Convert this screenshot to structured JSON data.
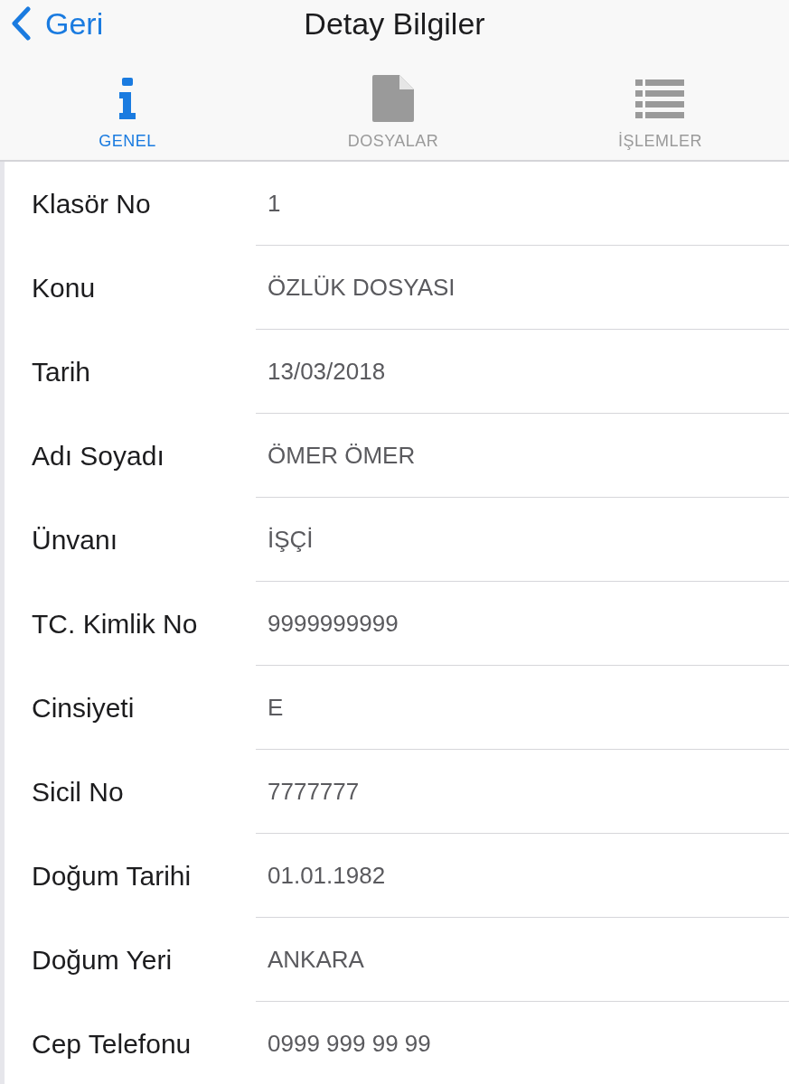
{
  "nav_bar": {
    "back": {
      "label": "Geri"
    },
    "title": "Detay Bilgiler"
  },
  "tabs": [
    {
      "label": "GENEL",
      "kind": "info",
      "selected": true
    },
    {
      "label": "DOSYALAR",
      "kind": "file",
      "selected": false
    },
    {
      "label": "İŞLEMLER",
      "kind": "list",
      "selected": false
    }
  ],
  "fields": [
    {
      "label": "Klasör No",
      "value": "1"
    },
    {
      "label": "Konu",
      "value": "ÖZLÜK DOSYASI"
    },
    {
      "label": "Tarih",
      "value": "13/03/2018"
    },
    {
      "label": "Adı Soyadı",
      "value": "ÖMER ÖMER"
    },
    {
      "label": "Ünvanı",
      "value": "İŞÇİ"
    },
    {
      "label": "TC. Kimlik No",
      "value": "9999999999"
    },
    {
      "label": "Cinsiyeti",
      "value": "E"
    },
    {
      "label": "Sicil No",
      "value": "7777777"
    },
    {
      "label": "Doğum Tarihi",
      "value": "01.01.1982"
    },
    {
      "label": "Doğum Yeri",
      "value": "ANKARA"
    },
    {
      "label": "Cep Telefonu",
      "value": "0999 999 99 99"
    }
  ]
}
